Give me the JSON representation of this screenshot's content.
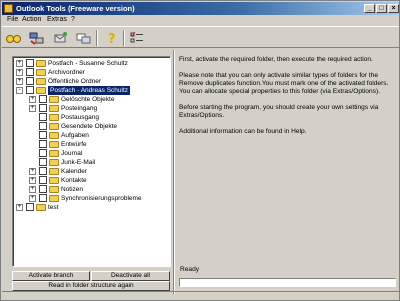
{
  "window": {
    "title": "Outlook Tools (Freeware version)"
  },
  "menu": [
    "File",
    "Action",
    "Extras",
    "?"
  ],
  "toolbar": {
    "icons": [
      "glasses-icon",
      "network-icon",
      "mailbox-icon",
      "mail-merge-icon",
      "help-icon",
      "checklist-icon"
    ]
  },
  "tree": {
    "nodes": [
      {
        "label": "Postfach - Susanne Schultz",
        "level": 0,
        "expander": "+",
        "checked": false
      },
      {
        "label": "Archivordner",
        "level": 0,
        "expander": "+",
        "checked": false
      },
      {
        "label": "Öffentliche Ordner",
        "level": 0,
        "expander": "+",
        "checked": false
      },
      {
        "label": "Postfach - Andreas Schultz",
        "level": 0,
        "expander": "-",
        "checked": false,
        "selected": true
      },
      {
        "label": "Gelöschte Objekte",
        "level": 1,
        "expander": "+",
        "checked": false
      },
      {
        "label": "Posteingang",
        "level": 1,
        "expander": "+",
        "checked": false
      },
      {
        "label": "Postausgang",
        "level": 1,
        "expander": "",
        "checked": false
      },
      {
        "label": "Gesendete Objekte",
        "level": 1,
        "expander": "",
        "checked": false
      },
      {
        "label": "Aufgaben",
        "level": 1,
        "expander": "",
        "checked": false
      },
      {
        "label": "Entwürfe",
        "level": 1,
        "expander": "",
        "checked": false
      },
      {
        "label": "Journal",
        "level": 1,
        "expander": "",
        "checked": false
      },
      {
        "label": "Junk-E-Mail",
        "level": 1,
        "expander": "",
        "checked": false
      },
      {
        "label": "Kalender",
        "level": 1,
        "expander": "+",
        "checked": false
      },
      {
        "label": "Kontakte",
        "level": 1,
        "expander": "+",
        "checked": false
      },
      {
        "label": "Notizen",
        "level": 1,
        "expander": "+",
        "checked": false
      },
      {
        "label": "Synchronisierungsprobleme",
        "level": 1,
        "expander": "+",
        "checked": false
      },
      {
        "label": "test",
        "level": 0,
        "expander": "+",
        "checked": false
      }
    ]
  },
  "buttons": {
    "activate_branch": "Activate branch",
    "deactivate_all": "Deactivate all",
    "read_folder_structure": "Read in folder structure again"
  },
  "info": {
    "p1": "First, activate the required folder, then execute the required action.",
    "p2": "Please note that you can only activate similar types of folders for the Remove duplicates function.You must mark one of the activated folders. You can allocate special properties to this folder (via Extras/Options).",
    "p3": "Before starting the program, you should create your own settings via Extras/Options.",
    "p4": "Additional information can be found in Help."
  },
  "status": {
    "label": "Ready",
    "progress": 0
  }
}
